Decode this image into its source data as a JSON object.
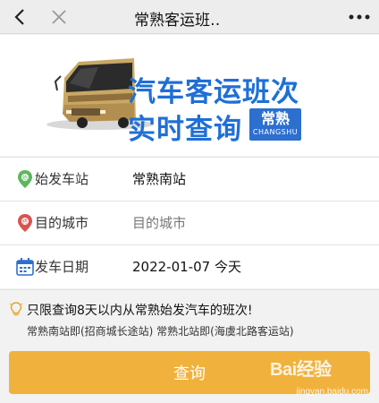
{
  "topbar": {
    "title": "常熟客运班‥",
    "back_icon": "chevron-left-icon",
    "close_icon": "close-icon",
    "more_icon": "more-icon"
  },
  "banner": {
    "line1": "汽车客运班次",
    "line2": "实时查询",
    "badge_cn": "常熟",
    "badge_en": "CHANGSHU",
    "image": "bus-illustration"
  },
  "form": {
    "departure": {
      "label": "始发车站",
      "value": "常熟南站",
      "icon": "location-pin-green-icon"
    },
    "destination": {
      "label": "目的城市",
      "placeholder": "目的城市",
      "icon": "location-pin-red-icon"
    },
    "date": {
      "label": "发车日期",
      "value": "2022-01-07 今天",
      "icon": "calendar-icon"
    }
  },
  "notice": {
    "line1": "只限查询8天以内从常熟始发汽车的班次!",
    "line2": "常熟南站即(招商城长途站) 常熟北站即(海虞北路客运站)",
    "icon": "lightbulb-icon"
  },
  "button": {
    "label": "查询"
  },
  "watermark": {
    "logo": "Bai经验",
    "url": "jingyan.baidu.com"
  },
  "colors": {
    "accent": "#f0b23c",
    "brand_blue": "#1f6fd6",
    "green_pin": "#5cb85c",
    "red_pin": "#d9534f",
    "calendar_blue": "#2c6fcf"
  }
}
